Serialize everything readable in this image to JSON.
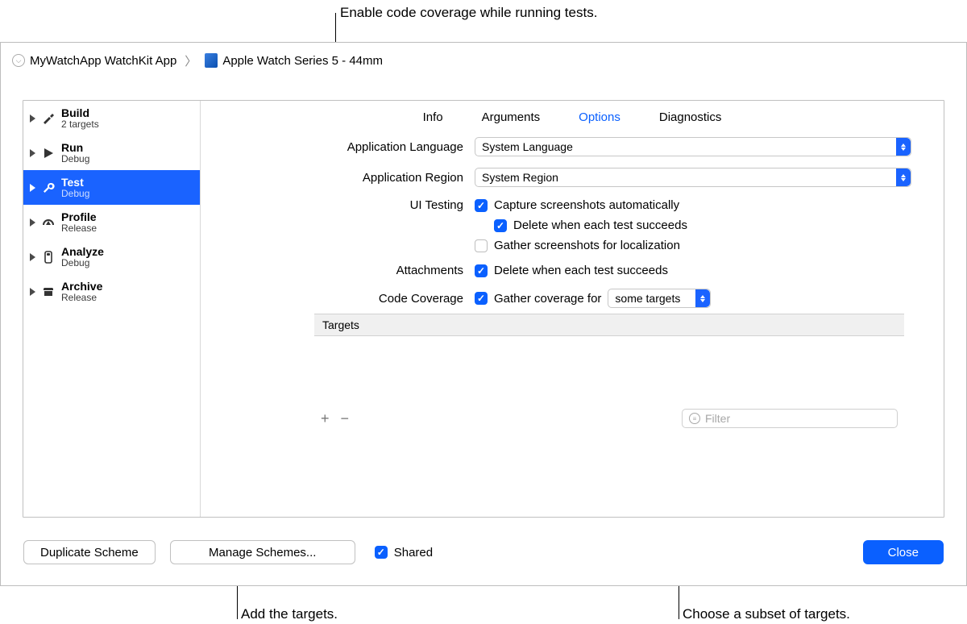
{
  "annotations": {
    "top": "Enable code coverage while running tests.",
    "bottom_left": "Add the targets.",
    "bottom_right": "Choose a subset of targets."
  },
  "breadcrumb": {
    "scheme": "MyWatchApp WatchKit App",
    "device": "Apple Watch Series 5 - 44mm"
  },
  "sidebar": {
    "items": [
      {
        "title": "Build",
        "subtitle": "2 targets",
        "icon": "hammer"
      },
      {
        "title": "Run",
        "subtitle": "Debug",
        "icon": "play"
      },
      {
        "title": "Test",
        "subtitle": "Debug",
        "icon": "wrench",
        "selected": true
      },
      {
        "title": "Profile",
        "subtitle": "Release",
        "icon": "gauge"
      },
      {
        "title": "Analyze",
        "subtitle": "Debug",
        "icon": "flask"
      },
      {
        "title": "Archive",
        "subtitle": "Release",
        "icon": "archive"
      }
    ]
  },
  "tabs": {
    "items": [
      "Info",
      "Arguments",
      "Options",
      "Diagnostics"
    ],
    "active_index": 2
  },
  "form": {
    "application_language": {
      "label": "Application Language",
      "value": "System Language"
    },
    "application_region": {
      "label": "Application Region",
      "value": "System Region"
    },
    "ui_testing": {
      "label": "UI Testing",
      "capture": {
        "checked": true,
        "text": "Capture screenshots automatically"
      },
      "delete": {
        "checked": true,
        "text": "Delete when each test succeeds"
      },
      "gather": {
        "checked": false,
        "text": "Gather screenshots for localization"
      }
    },
    "attachments": {
      "label": "Attachments",
      "delete": {
        "checked": true,
        "text": "Delete when each test succeeds"
      }
    },
    "code_coverage": {
      "label": "Code Coverage",
      "enabled": {
        "checked": true,
        "text": "Gather coverage for"
      },
      "scope_value": "some targets"
    },
    "targets": {
      "header": "Targets",
      "add": "+",
      "remove": "−",
      "filter_placeholder": "Filter"
    }
  },
  "bottom": {
    "duplicate": "Duplicate Scheme",
    "manage": "Manage Schemes...",
    "shared": {
      "checked": true,
      "text": "Shared"
    },
    "close": "Close"
  }
}
